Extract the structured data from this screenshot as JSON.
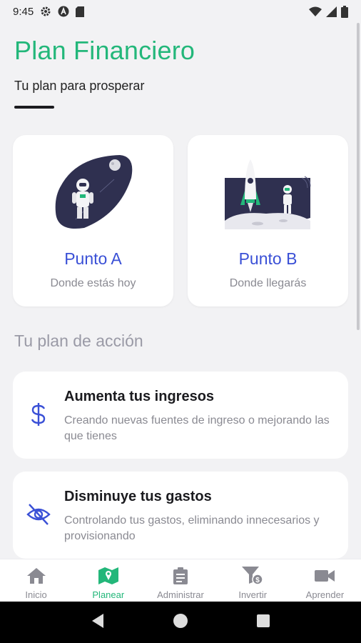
{
  "status_bar": {
    "time": "9:45",
    "left_icons": [
      "gear-icon",
      "a-circle-icon",
      "sd-card-icon"
    ],
    "right_icons": [
      "wifi-icon",
      "signal-icon",
      "battery-icon"
    ]
  },
  "header": {
    "title": "Plan Financiero",
    "subtitle": "Tu plan para prosperar",
    "title_color": "#23b77a"
  },
  "points": [
    {
      "title": "Punto A",
      "description": "Donde estás hoy",
      "illustration": "astronaut-illustration"
    },
    {
      "title": "Punto B",
      "description": "Donde llegarás",
      "illustration": "rocket-moon-illustration"
    }
  ],
  "action_section": {
    "title": "Tu plan de acción",
    "items": [
      {
        "title": "Aumenta tus ingresos",
        "description": "Creando nuevas fuentes de ingreso o mejorando las que tienes",
        "icon": "dollar-icon"
      },
      {
        "title": "Disminuye tus gastos",
        "description": "Controlando tus gastos, eliminando innecesarios y provisionando",
        "icon": "eye-off-icon"
      }
    ]
  },
  "bottom_nav": {
    "active_index": 1,
    "active_color": "#23b77a",
    "items": [
      {
        "label": "Inicio",
        "icon": "home-icon"
      },
      {
        "label": "Planear",
        "icon": "map-icon"
      },
      {
        "label": "Administrar",
        "icon": "clipboard-icon"
      },
      {
        "label": "Invertir",
        "icon": "funnel-dollar-icon"
      },
      {
        "label": "Aprender",
        "icon": "video-camera-icon"
      }
    ]
  },
  "system_nav": [
    "back-icon",
    "home-circle-icon",
    "recents-icon"
  ],
  "colors": {
    "accent_blue": "#3a50d6",
    "muted_text": "#8a8a92",
    "background": "#f2f2f4"
  }
}
